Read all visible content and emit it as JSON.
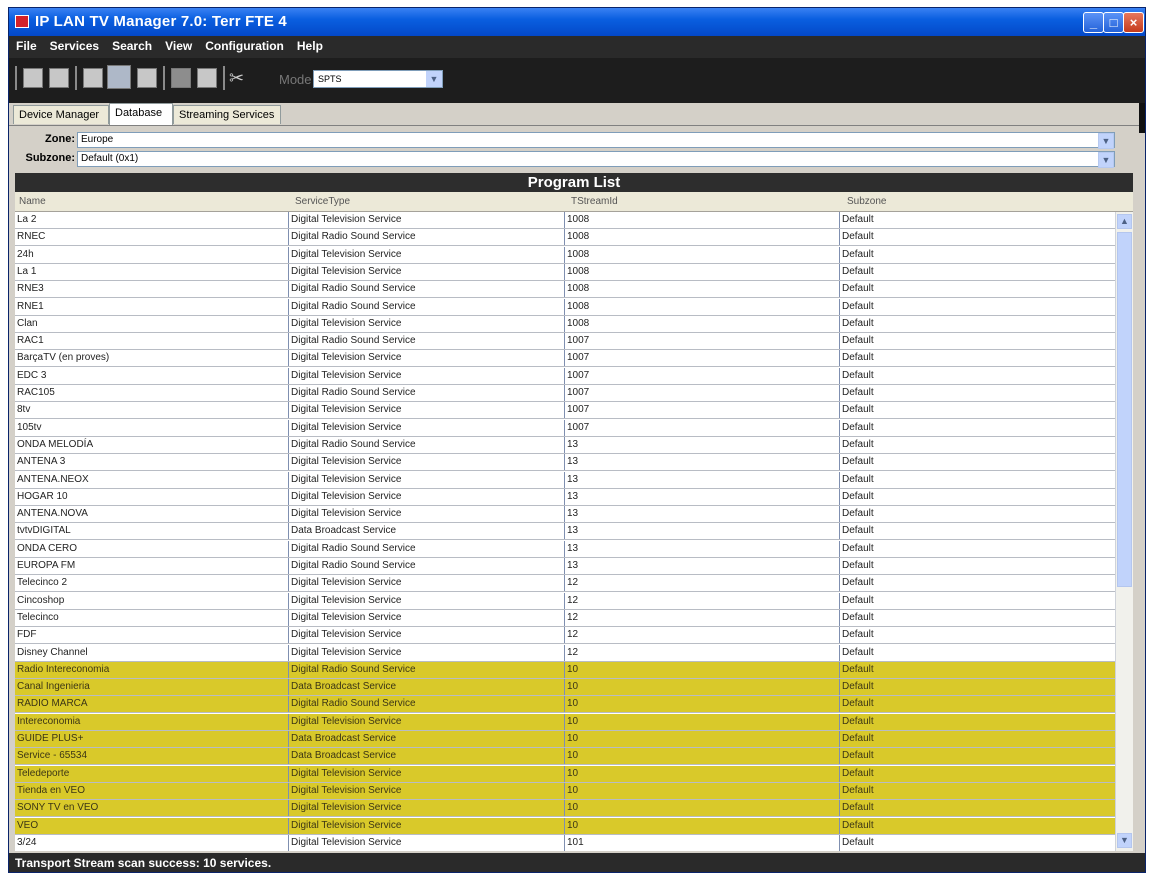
{
  "window": {
    "title": "IP LAN TV Manager 7.0: Terr FTE 4"
  },
  "menu": [
    "File",
    "Services",
    "Search",
    "View",
    "Configuration",
    "Help"
  ],
  "toolbar": {
    "icons": [
      "import-icon",
      "export-icon",
      "refresh-icon",
      "scan-icon",
      "binoculars-icon",
      "stop-icon",
      "document-icon",
      "tools-icon"
    ],
    "mode_label": "Mode",
    "mode_value": "SPTS"
  },
  "tabs": [
    {
      "label": "Device Manager",
      "active": false
    },
    {
      "label": "Database",
      "active": true
    },
    {
      "label": "Streaming Services",
      "active": false
    }
  ],
  "zone": {
    "label": "Zone:",
    "value": "Europe"
  },
  "subzone": {
    "label": "Subzone:",
    "value": "Default (0x1)"
  },
  "program_list": {
    "title": "Program List",
    "columns": [
      "Name",
      "ServiceType",
      "TStreamId",
      "Subzone"
    ],
    "rows": [
      {
        "name": "La 2",
        "type": "Digital Television Service",
        "tsid": "1008",
        "subzone": "Default",
        "highlight": false
      },
      {
        "name": "RNEC",
        "type": "Digital Radio Sound Service",
        "tsid": "1008",
        "subzone": "Default",
        "highlight": false
      },
      {
        "name": "24h",
        "type": "Digital Television Service",
        "tsid": "1008",
        "subzone": "Default",
        "highlight": false
      },
      {
        "name": "La 1",
        "type": "Digital Television Service",
        "tsid": "1008",
        "subzone": "Default",
        "highlight": false
      },
      {
        "name": "RNE3",
        "type": "Digital Radio Sound Service",
        "tsid": "1008",
        "subzone": "Default",
        "highlight": false
      },
      {
        "name": "RNE1",
        "type": "Digital Radio Sound Service",
        "tsid": "1008",
        "subzone": "Default",
        "highlight": false
      },
      {
        "name": "Clan",
        "type": "Digital Television Service",
        "tsid": "1008",
        "subzone": "Default",
        "highlight": false
      },
      {
        "name": "RAC1",
        "type": "Digital Radio Sound Service",
        "tsid": "1007",
        "subzone": "Default",
        "highlight": false
      },
      {
        "name": "BarçaTV (en proves)",
        "type": "Digital Television Service",
        "tsid": "1007",
        "subzone": "Default",
        "highlight": false
      },
      {
        "name": "EDC 3",
        "type": "Digital Television Service",
        "tsid": "1007",
        "subzone": "Default",
        "highlight": false
      },
      {
        "name": "RAC105",
        "type": "Digital Radio Sound Service",
        "tsid": "1007",
        "subzone": "Default",
        "highlight": false
      },
      {
        "name": "8tv",
        "type": "Digital Television Service",
        "tsid": "1007",
        "subzone": "Default",
        "highlight": false
      },
      {
        "name": "105tv",
        "type": "Digital Television Service",
        "tsid": "1007",
        "subzone": "Default",
        "highlight": false
      },
      {
        "name": "ONDA MELODÍA",
        "type": "Digital Radio Sound Service",
        "tsid": "13",
        "subzone": "Default",
        "highlight": false
      },
      {
        "name": "ANTENA 3",
        "type": "Digital Television Service",
        "tsid": "13",
        "subzone": "Default",
        "highlight": false
      },
      {
        "name": "ANTENA.NEOX",
        "type": "Digital Television Service",
        "tsid": "13",
        "subzone": "Default",
        "highlight": false
      },
      {
        "name": "HOGAR 10",
        "type": "Digital Television Service",
        "tsid": "13",
        "subzone": "Default",
        "highlight": false
      },
      {
        "name": "ANTENA.NOVA",
        "type": "Digital Television Service",
        "tsid": "13",
        "subzone": "Default",
        "highlight": false
      },
      {
        "name": "tvtvDIGITAL",
        "type": "Data Broadcast Service",
        "tsid": "13",
        "subzone": "Default",
        "highlight": false
      },
      {
        "name": "ONDA CERO",
        "type": "Digital Radio Sound Service",
        "tsid": "13",
        "subzone": "Default",
        "highlight": false
      },
      {
        "name": "EUROPA FM",
        "type": "Digital Radio Sound Service",
        "tsid": "13",
        "subzone": "Default",
        "highlight": false
      },
      {
        "name": "Telecinco 2",
        "type": "Digital Television Service",
        "tsid": "12",
        "subzone": "Default",
        "highlight": false
      },
      {
        "name": "Cincoshop",
        "type": "Digital Television Service",
        "tsid": "12",
        "subzone": "Default",
        "highlight": false
      },
      {
        "name": "Telecinco",
        "type": "Digital Television Service",
        "tsid": "12",
        "subzone": "Default",
        "highlight": false
      },
      {
        "name": "FDF",
        "type": "Digital Television Service",
        "tsid": "12",
        "subzone": "Default",
        "highlight": false
      },
      {
        "name": "Disney Channel",
        "type": "Digital Television Service",
        "tsid": "12",
        "subzone": "Default",
        "highlight": false
      },
      {
        "name": "Radio Intereconomia",
        "type": "Digital Radio Sound Service",
        "tsid": "10",
        "subzone": "Default",
        "highlight": true
      },
      {
        "name": "Canal Ingenieria",
        "type": "Data Broadcast Service",
        "tsid": "10",
        "subzone": "Default",
        "highlight": true
      },
      {
        "name": "RADIO MARCA",
        "type": "Digital Radio Sound Service",
        "tsid": "10",
        "subzone": "Default",
        "highlight": true
      },
      {
        "name": "Intereconomia",
        "type": "Digital Television Service",
        "tsid": "10",
        "subzone": "Default",
        "highlight": true
      },
      {
        "name": "GUIDE PLUS+",
        "type": "Data Broadcast Service",
        "tsid": "10",
        "subzone": "Default",
        "highlight": true
      },
      {
        "name": "Service - 65534",
        "type": "Data Broadcast Service",
        "tsid": "10",
        "subzone": "Default",
        "highlight": true
      },
      {
        "name": "Teledeporte",
        "type": "Digital Television Service",
        "tsid": "10",
        "subzone": "Default",
        "highlight": true
      },
      {
        "name": "Tienda en VEO",
        "type": "Digital Television Service",
        "tsid": "10",
        "subzone": "Default",
        "highlight": true
      },
      {
        "name": "SONY TV en VEO",
        "type": "Digital Television Service",
        "tsid": "10",
        "subzone": "Default",
        "highlight": true
      },
      {
        "name": "VEO",
        "type": "Digital Television Service",
        "tsid": "10",
        "subzone": "Default",
        "highlight": true
      },
      {
        "name": "3/24",
        "type": "Digital Television Service",
        "tsid": "101",
        "subzone": "Default",
        "highlight": false
      }
    ]
  },
  "status": "Transport Stream scan success: 10 services.",
  "colors": {
    "highlight_row": "#d9c92a",
    "titlebar": "#0a5fe0",
    "menubar": "#2a2a2a"
  }
}
